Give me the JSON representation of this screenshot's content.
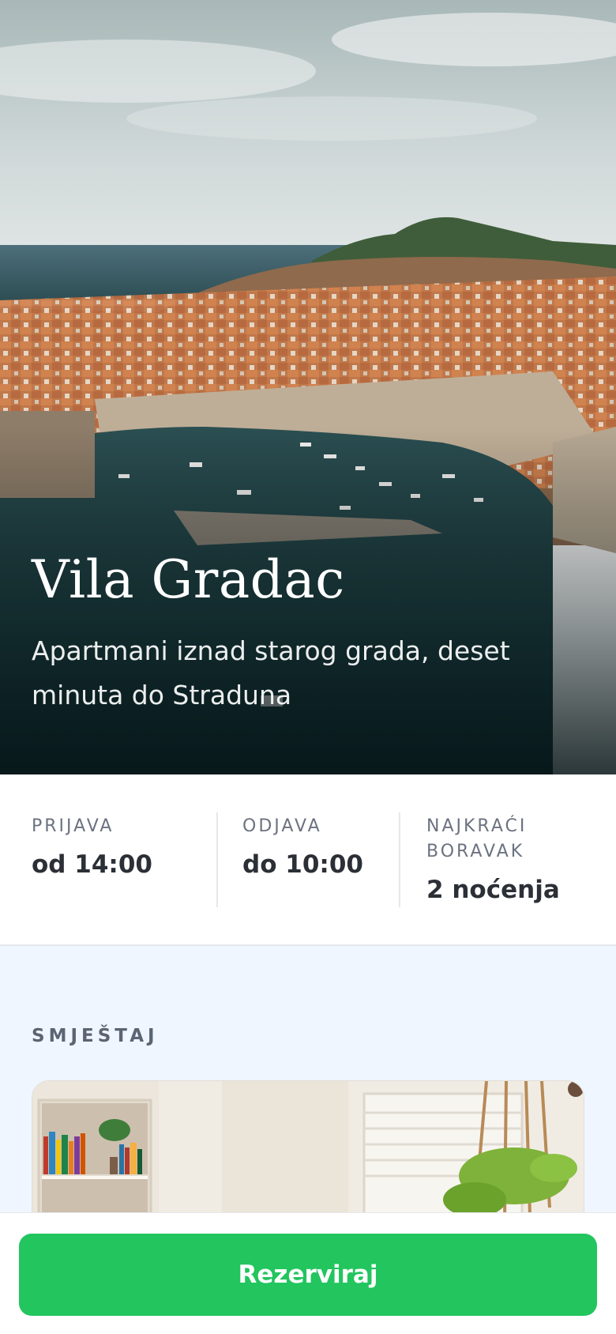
{
  "hero": {
    "image_name": "dubrovnik-harbor-photo",
    "title": "Vila Gradac",
    "subtitle": "Apartmani iznad starog grada, deset minuta do Straduna"
  },
  "info": [
    {
      "label": "PRIJAVA",
      "value": "od 14:00"
    },
    {
      "label": "ODJAVA",
      "value": "do 10:00"
    },
    {
      "label": "NAJKRAĆI BORAVAK",
      "value": "2 noćenja"
    }
  ],
  "section": {
    "label": "SMJEŠTAJ",
    "image_name": "apartment-room-photo"
  },
  "cta": {
    "label": "Rezerviraj",
    "color": "#22c55e"
  }
}
